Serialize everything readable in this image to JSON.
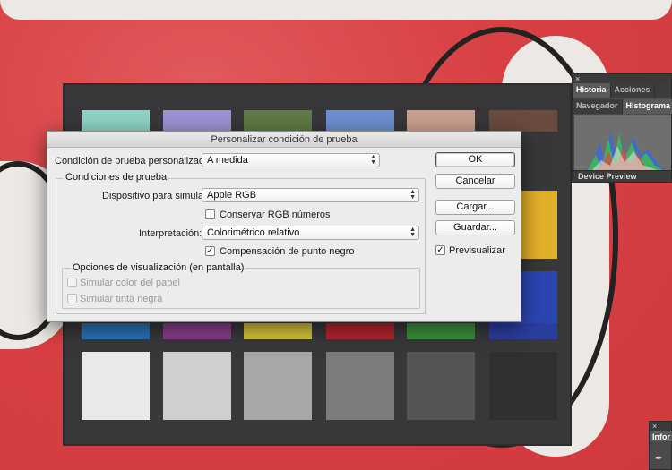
{
  "dialog": {
    "title": "Personalizar condición de prueba",
    "custom_condition_label": "Condición de prueba personalizada:",
    "custom_condition_value": "A medida",
    "proof_conditions_group": "Condiciones de prueba",
    "device_label": "Dispositivo para simular:",
    "device_value": "Apple RGB",
    "preserve_rgb_label": "Conservar RGB números",
    "preserve_rgb_checked": false,
    "intent_label": "Interpretación:",
    "intent_value": "Colorimétrico relativo",
    "black_point_label": "Compensación de punto negro",
    "black_point_checked": true,
    "display_options_group": "Opciones de visualización (en pantalla)",
    "simulate_paper_label": "Simular color del papel",
    "simulate_black_ink_label": "Simular tinta negra",
    "buttons": {
      "ok": "OK",
      "cancel": "Cancelar",
      "load": "Cargar...",
      "save": "Guardar..."
    },
    "preview_label": "Previsualizar",
    "preview_checked": true,
    "check_mark": "✓",
    "arrow_up": "▲",
    "arrow_down": "▼"
  },
  "panels": {
    "close_glyph": "×",
    "tabs_top": [
      "Historia",
      "Acciones"
    ],
    "tabs_bottom": [
      "Navegador",
      "Histograma"
    ],
    "device_preview": "Device Preview",
    "info_tab": "Infor"
  },
  "colors": {
    "swatches_row1": [
      "#8fd3c6",
      "#9b93d4",
      "#5f7a43",
      "#6d8fcf",
      "#c9a08f",
      "#6b4a3f"
    ],
    "swatches_row3": [
      "#2a73b5",
      "#8b3f8d",
      "#d4c33a",
      "#b3262e",
      "#3d8f3e",
      "#2a3e9e"
    ],
    "swatches_row4": [
      "#e9e9e9",
      "#cfcfcf",
      "#a7a7a7",
      "#7c7c7c",
      "#555556",
      "#303031"
    ],
    "right_side": [
      "#e3b02a",
      "#2b45b3"
    ]
  }
}
